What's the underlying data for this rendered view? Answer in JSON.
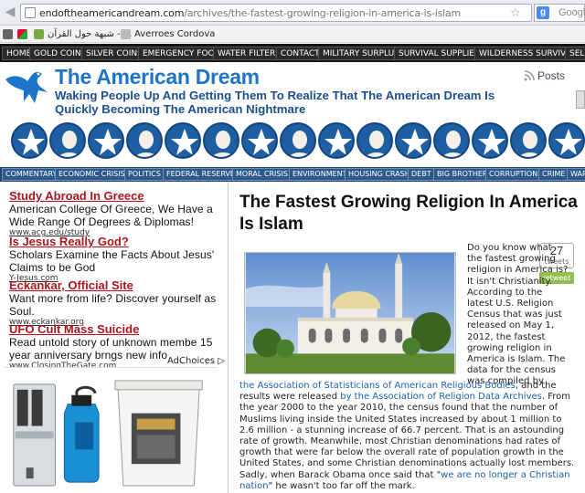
{
  "browser": {
    "url_domain": "endoftheamericandream.com",
    "url_path": "/archives/the-fastest-growing-religion-in-america-is-islam",
    "search_engine": "Google",
    "bookmarks": [
      "شبهة حول القرآن - ...",
      "Averroes Cordova"
    ]
  },
  "topnav": [
    "HOME",
    "GOLD COINS",
    "SILVER COINS",
    "EMERGENCY FOOD",
    "WATER FILTERS",
    "CONTACT",
    "MILITARY SURPLUS",
    "SURVIVAL SUPPLIES",
    "WILDERNESS SURVIVAL",
    "SELF"
  ],
  "header": {
    "title": "The American Dream",
    "tagline": "Waking People Up And Getting Them To Realize That The American Dream Is Quickly Becoming The American Nightmare",
    "posts_label": "Posts"
  },
  "catnav": [
    "COMMENTARY",
    "ECONOMIC CRISIS",
    "POLITICS",
    "FEDERAL RESERVE",
    "MORAL CRISIS",
    "ENVIRONMENT",
    "HOUSING CRASH",
    "DEBT",
    "BIG BROTHER",
    "CORRUPTION",
    "CRIME",
    "WAR"
  ],
  "ads": [
    {
      "title": "Study Abroad In Greece",
      "desc": "American College Of Greece, We Have a Wide Range Of Degrees & Diplomas!",
      "url": "www.acg.edu/study"
    },
    {
      "title": "Is Jesus Really God?",
      "desc": "Scholars Examine the Facts About Jesus' Claims to be God",
      "url": "Y-Jesus.com"
    },
    {
      "title": "Eckankar, Official Site",
      "desc": "Want more from life? Discover yourself as Soul.",
      "url": "www.eckankar.org"
    },
    {
      "title": "UFO Cult Mass Suicide",
      "desc": "Read untold story of unknown membe 15 year anniversary brngs new info",
      "url": "www.ClosingTheGate.com"
    }
  ],
  "adchoices": "AdChoices",
  "article": {
    "title": "The Fastest Growing Religion In America Is Islam",
    "tweet_count": "27",
    "tweet_label": "tweets",
    "retweet_label": "retweet",
    "p_right": "Do you know what the fastest growing religion in America is?  It isn't Christianity.  According to the latest U.S. Religion Census that was just released on May 1, 2012, the fastest growing religion in America is Islam.  The data for the census was compiled by",
    "link1": "the Association of Statisticians of American Religious Bodies",
    "p_mid": ", and the results were released ",
    "link2": "by the Association of Religion Data Archives",
    "p_body": ".  From the year 2000 to the year 2010, the census found that the number of Muslims living inside the United States increased by about 1 million to 2.6 million - a stunning increase of 66.7 percent.  That is an astounding rate of growth.  Meanwhile, most Christian denominations had rates of growth that were far below the overall rate of population growth in the United States, and some Christian denominations actually lost members.  Sadly, when Barack Obama once said that \"",
    "link3": "we are no longer a Christian nation",
    "p_end": "\" he wasn't too far off the mark."
  },
  "colors": {
    "brand_blue": "#1d74c8",
    "nav_dark": "#151515",
    "cat_blue": "#1e4570",
    "ad_red": "#b0141e",
    "link_blue": "#1c5fa8"
  }
}
